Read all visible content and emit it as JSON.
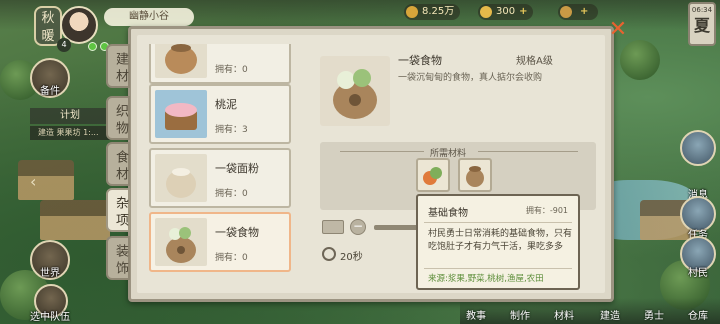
{
  "hud": {
    "season_left": "秋暖",
    "avatar_level": "4",
    "player_name": "幽静小谷",
    "coins": "8.25万",
    "gems": "300",
    "clock_time": "06:34",
    "season_right": "夏"
  },
  "left_nav": {
    "top_label": "备件",
    "plan_tag": "计划",
    "plan_row": "建造 果果坊 1:...",
    "world_label": "世界",
    "team_label": "选中队伍"
  },
  "right_nav": {
    "messages": "消息",
    "tasks": "任务",
    "villagers": "村民"
  },
  "bottom_nav": [
    "教事",
    "制作",
    "材料",
    "建造",
    "勇士",
    "仓库"
  ],
  "tabs": [
    {
      "label": "建材",
      "active": false
    },
    {
      "label": "织物",
      "active": false
    },
    {
      "label": "食材",
      "active": false
    },
    {
      "label": "杂项",
      "active": true
    },
    {
      "label": "装饰",
      "active": false
    }
  ],
  "items": [
    {
      "name": "",
      "owned": "拥有：0"
    },
    {
      "name": "桃泥",
      "owned": "拥有：3"
    },
    {
      "name": "一袋面粉",
      "owned": "拥有：0"
    },
    {
      "name": "一袋食物",
      "owned": "拥有：0"
    }
  ],
  "detail": {
    "name": "一袋食物",
    "spec": "规格A级",
    "desc": "一袋沉甸甸的食物，真人掂尔会收购",
    "materials_title": "所需材料",
    "time": "20秒"
  },
  "tooltip": {
    "title": "基础食物",
    "owned": "拥有：-901",
    "body": "村民勇士日常消耗的基础食物，只有吃饱肚子才有力气干活，果吃多多",
    "source": "来源:浆果,野菜,桃树,渔屋,农田"
  },
  "colors": {
    "close": "#e9622f",
    "selected_border": "#f0b689",
    "source_text": "#5d8e3a"
  },
  "close_icon": "✕"
}
